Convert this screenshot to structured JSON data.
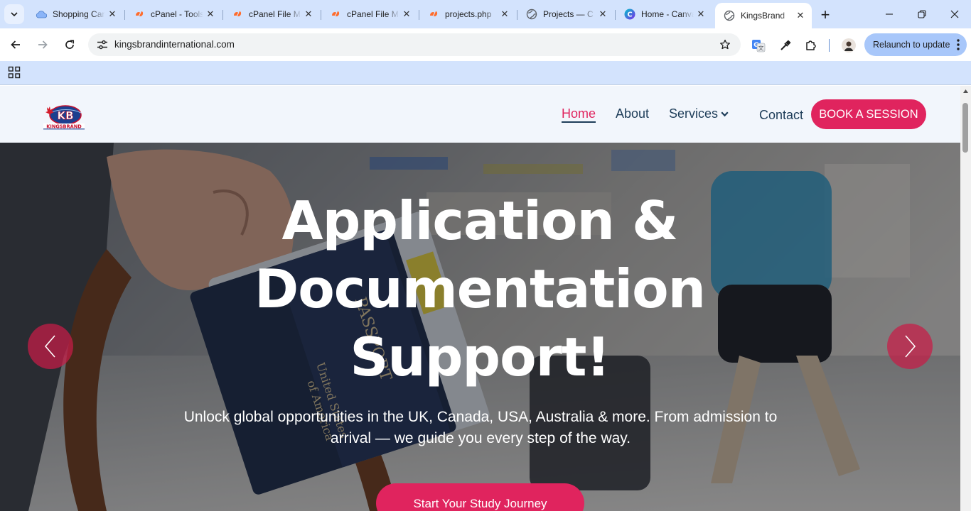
{
  "browser": {
    "tabs": [
      {
        "title": "Shopping Cart",
        "favicon": "cloud-icon",
        "color": "#6fa8dc"
      },
      {
        "title": "cPanel - Tools",
        "favicon": "cpanel-icon",
        "color": "#ff6c2c"
      },
      {
        "title": "cPanel File Manager",
        "favicon": "cpanel-icon",
        "color": "#ff6c2c"
      },
      {
        "title": "cPanel File Manager",
        "favicon": "cpanel-icon",
        "color": "#ff6c2c"
      },
      {
        "title": "projects.php",
        "favicon": "cpanel-icon",
        "color": "#ff6c2c"
      },
      {
        "title": "Projects — C",
        "favicon": "globe-icon",
        "color": "#5f6368"
      },
      {
        "title": "Home - Canva",
        "favicon": "canva-icon",
        "color": "#7d2ae8"
      },
      {
        "title": "KingsBrand",
        "favicon": "globe-icon",
        "color": "#5f6368",
        "active": true
      }
    ],
    "url": "kingsbrandinternational.com",
    "relaunch_label": "Relaunch to update"
  },
  "site": {
    "logo_alt": "KB KINGSBRAND",
    "logo_text": "KINGSBRAND",
    "nav": {
      "home": "Home",
      "about": "About",
      "services": "Services",
      "contact": "Contact"
    },
    "book_button": "BOOK A SESSION",
    "hero": {
      "title_line1": "Application &",
      "title_line2": "Documentation",
      "title_line3": "Support!",
      "subtitle": "Unlock global opportunities in the UK, Canada, USA, Australia & more. From admission to arrival — we guide you every step of the way.",
      "cta": "Start Your Study Journey"
    }
  },
  "colors": {
    "accent": "#e0245e",
    "nav_text": "#1e3d59",
    "header_bg": "#f2f6fc",
    "chrome_bg": "#d3e3fd"
  }
}
